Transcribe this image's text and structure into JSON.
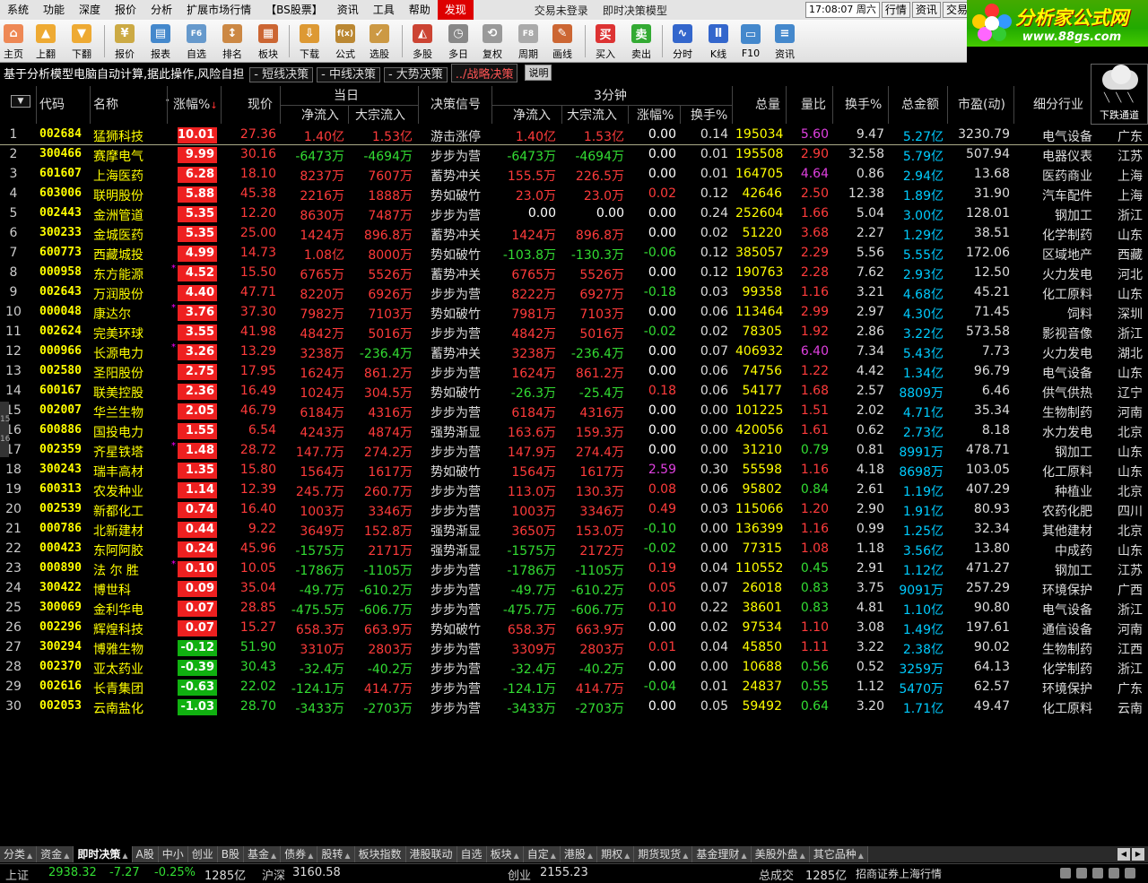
{
  "menu": {
    "items": [
      "系统",
      "功能",
      "深度",
      "报价",
      "分析",
      "扩展市场行情",
      "【BS股票】",
      "资讯",
      "工具",
      "帮助",
      "发现"
    ],
    "active": "发现",
    "title_left": "交易未登录",
    "title_right": "即时决策模型",
    "clock": "17:08:07 周六",
    "right_buttons": [
      "行情",
      "资讯",
      "交易"
    ]
  },
  "logo": {
    "name": "分析家公式网",
    "url": "www.88gs.com"
  },
  "toolbar": [
    {
      "label": "主页",
      "icon": "home-icon"
    },
    {
      "label": "上翻",
      "icon": "up-arrow-icon"
    },
    {
      "label": "下翻",
      "icon": "down-arrow-icon"
    },
    {
      "label": "报价",
      "icon": "yen-icon"
    },
    {
      "label": "报表",
      "icon": "report-icon"
    },
    {
      "label": "自选",
      "icon": "f6-icon"
    },
    {
      "label": "排名",
      "icon": "rank-icon"
    },
    {
      "label": "板块",
      "icon": "blocks-icon"
    },
    {
      "label": "下载",
      "icon": "download-icon"
    },
    {
      "label": "公式",
      "icon": "formula-icon"
    },
    {
      "label": "选股",
      "icon": "select-stock-icon"
    },
    {
      "label": "多股",
      "icon": "multi-stock-icon"
    },
    {
      "label": "多日",
      "icon": "clock-icon"
    },
    {
      "label": "复权",
      "icon": "restore-icon"
    },
    {
      "label": "周期",
      "icon": "f8-icon"
    },
    {
      "label": "画线",
      "icon": "draw-line-icon"
    },
    {
      "label": "买入",
      "icon": "buy-icon"
    },
    {
      "label": "卖出",
      "icon": "sell-icon"
    },
    {
      "label": "分时",
      "icon": "intraday-icon"
    },
    {
      "label": "K线",
      "icon": "kline-icon"
    },
    {
      "label": "F10",
      "icon": "f10-icon"
    },
    {
      "label": "资讯",
      "icon": "news-icon"
    }
  ],
  "infobar": {
    "desc": "基于分析模型电脑自动计算,据此操作,风险自担",
    "tags": [
      "短线决策",
      "中线决策",
      "大势决策"
    ],
    "highlight": "战略决策",
    "help": "说明"
  },
  "weather": {
    "label": "下跌通道"
  },
  "header": {
    "code": "代码",
    "name": "名称",
    "chg": "涨幅%",
    "price": "现价",
    "group_day": "当日",
    "day_net": "净流入",
    "day_big": "大宗流入",
    "signal": "决策信号",
    "group_3m": "3分钟",
    "m_net": "净流入",
    "m_big": "大宗流入",
    "m_chg": "涨幅%",
    "m_turn": "换手%",
    "vol": "总量",
    "vr": "量比",
    "turn": "换手%",
    "amt": "总金额",
    "pe": "市盈(动)",
    "ind": "细分行业"
  },
  "rows": [
    {
      "no": "1",
      "code": "002684",
      "name": "猛狮科技",
      "star": false,
      "chg": "10.01",
      "price": "27.36",
      "d1": "1.40亿",
      "d2": "1.53亿",
      "sig": "游击涨停",
      "m1": "1.40亿",
      "m2": "1.53亿",
      "mc": "0.00",
      "mh": "0.14",
      "vol": "195034",
      "vr": "5.60",
      "turn": "9.47",
      "amt": "5.27亿",
      "pe": "3230.79",
      "ind": "电气设备",
      "reg": "广东"
    },
    {
      "no": "2",
      "code": "300466",
      "name": "赛摩电气",
      "star": false,
      "chg": "9.99",
      "price": "30.16",
      "d1": "-6473万",
      "d2": "-4694万",
      "sig": "步步为营",
      "m1": "-6473万",
      "m2": "-4694万",
      "mc": "0.00",
      "mh": "0.01",
      "vol": "195508",
      "vr": "2.90",
      "turn": "32.58",
      "amt": "5.79亿",
      "pe": "507.94",
      "ind": "电器仪表",
      "reg": "江苏"
    },
    {
      "no": "3",
      "code": "601607",
      "name": "上海医药",
      "star": false,
      "chg": "6.28",
      "price": "18.10",
      "d1": "8237万",
      "d2": "7607万",
      "sig": "蓄势冲关",
      "m1": "155.5万",
      "m2": "226.5万",
      "mc": "0.00",
      "mh": "0.01",
      "vol": "164705",
      "vr": "4.64",
      "turn": "0.86",
      "amt": "2.94亿",
      "pe": "13.68",
      "ind": "医药商业",
      "reg": "上海"
    },
    {
      "no": "4",
      "code": "603006",
      "name": "联明股份",
      "star": false,
      "chg": "5.88",
      "price": "45.38",
      "d1": "2216万",
      "d2": "1888万",
      "sig": "势如破竹",
      "m1": "23.0万",
      "m2": "23.0万",
      "mc": "0.02",
      "mh": "0.12",
      "vol": "42646",
      "vr": "2.50",
      "turn": "12.38",
      "amt": "1.89亿",
      "pe": "31.90",
      "ind": "汽车配件",
      "reg": "上海"
    },
    {
      "no": "5",
      "code": "002443",
      "name": "金洲管道",
      "star": false,
      "chg": "5.35",
      "price": "12.20",
      "d1": "8630万",
      "d2": "7487万",
      "sig": "步步为营",
      "m1": "0.00",
      "m2": "0.00",
      "mc": "0.00",
      "mh": "0.24",
      "vol": "252604",
      "vr": "1.66",
      "turn": "5.04",
      "amt": "3.00亿",
      "pe": "128.01",
      "ind": "钢加工",
      "reg": "浙江"
    },
    {
      "no": "6",
      "code": "300233",
      "name": "金城医药",
      "star": false,
      "chg": "5.35",
      "price": "25.00",
      "d1": "1424万",
      "d2": "896.8万",
      "sig": "蓄势冲关",
      "m1": "1424万",
      "m2": "896.8万",
      "mc": "0.00",
      "mh": "0.02",
      "vol": "51220",
      "vr": "3.68",
      "turn": "2.27",
      "amt": "1.29亿",
      "pe": "38.51",
      "ind": "化学制药",
      "reg": "山东"
    },
    {
      "no": "7",
      "code": "600773",
      "name": "西藏城投",
      "star": false,
      "chg": "4.99",
      "price": "14.73",
      "d1": "1.08亿",
      "d2": "8000万",
      "sig": "势如破竹",
      "m1": "-103.8万",
      "m2": "-130.3万",
      "mc": "-0.06",
      "mh": "0.12",
      "vol": "385057",
      "vr": "2.29",
      "turn": "5.56",
      "amt": "5.55亿",
      "pe": "172.06",
      "ind": "区域地产",
      "reg": "西藏"
    },
    {
      "no": "8",
      "code": "000958",
      "name": "东方能源",
      "star": true,
      "chg": "4.52",
      "price": "15.50",
      "d1": "6765万",
      "d2": "5526万",
      "sig": "蓄势冲关",
      "m1": "6765万",
      "m2": "5526万",
      "mc": "0.00",
      "mh": "0.12",
      "vol": "190763",
      "vr": "2.28",
      "turn": "7.62",
      "amt": "2.93亿",
      "pe": "12.50",
      "ind": "火力发电",
      "reg": "河北"
    },
    {
      "no": "9",
      "code": "002643",
      "name": "万润股份",
      "star": false,
      "chg": "4.40",
      "price": "47.71",
      "d1": "8220万",
      "d2": "6926万",
      "sig": "步步为营",
      "m1": "8222万",
      "m2": "6927万",
      "mc": "-0.18",
      "mh": "0.03",
      "vol": "99358",
      "vr": "1.16",
      "turn": "3.21",
      "amt": "4.68亿",
      "pe": "45.21",
      "ind": "化工原料",
      "reg": "山东"
    },
    {
      "no": "10",
      "code": "000048",
      "name": "康达尔",
      "star": true,
      "chg": "3.76",
      "price": "37.30",
      "d1": "7982万",
      "d2": "7103万",
      "sig": "势如破竹",
      "m1": "7981万",
      "m2": "7103万",
      "mc": "0.00",
      "mh": "0.06",
      "vol": "113464",
      "vr": "2.99",
      "turn": "2.97",
      "amt": "4.30亿",
      "pe": "71.45",
      "ind": "饲料",
      "reg": "深圳"
    },
    {
      "no": "11",
      "code": "002624",
      "name": "完美环球",
      "star": false,
      "chg": "3.55",
      "price": "41.98",
      "d1": "4842万",
      "d2": "5016万",
      "sig": "步步为营",
      "m1": "4842万",
      "m2": "5016万",
      "mc": "-0.02",
      "mh": "0.02",
      "vol": "78305",
      "vr": "1.92",
      "turn": "2.86",
      "amt": "3.22亿",
      "pe": "573.58",
      "ind": "影视音像",
      "reg": "浙江"
    },
    {
      "no": "12",
      "code": "000966",
      "name": "长源电力",
      "star": true,
      "chg": "3.26",
      "price": "13.29",
      "d1": "3238万",
      "d2": "-236.4万",
      "sig": "蓄势冲关",
      "m1": "3238万",
      "m2": "-236.4万",
      "mc": "0.00",
      "mh": "0.07",
      "vol": "406932",
      "vr": "6.40",
      "turn": "7.34",
      "amt": "5.43亿",
      "pe": "7.73",
      "ind": "火力发电",
      "reg": "湖北"
    },
    {
      "no": "13",
      "code": "002580",
      "name": "圣阳股份",
      "star": false,
      "chg": "2.75",
      "price": "17.95",
      "d1": "1624万",
      "d2": "861.2万",
      "sig": "步步为营",
      "m1": "1624万",
      "m2": "861.2万",
      "mc": "0.00",
      "mh": "0.06",
      "vol": "74756",
      "vr": "1.22",
      "turn": "4.42",
      "amt": "1.34亿",
      "pe": "96.79",
      "ind": "电气设备",
      "reg": "山东"
    },
    {
      "no": "14",
      "code": "600167",
      "name": "联美控股",
      "star": false,
      "chg": "2.36",
      "price": "16.49",
      "d1": "1024万",
      "d2": "304.5万",
      "sig": "势如破竹",
      "m1": "-26.3万",
      "m2": "-25.4万",
      "mc": "0.18",
      "mh": "0.06",
      "vol": "54177",
      "vr": "1.68",
      "turn": "2.57",
      "amt": "8809万",
      "pe": "6.46",
      "ind": "供气供热",
      "reg": "辽宁"
    },
    {
      "no": "15",
      "code": "002007",
      "name": "华兰生物",
      "star": false,
      "chg": "2.05",
      "price": "46.79",
      "d1": "6184万",
      "d2": "4316万",
      "sig": "步步为营",
      "m1": "6184万",
      "m2": "4316万",
      "mc": "0.00",
      "mh": "0.00",
      "vol": "101225",
      "vr": "1.51",
      "turn": "2.02",
      "amt": "4.71亿",
      "pe": "35.34",
      "ind": "生物制药",
      "reg": "河南"
    },
    {
      "no": "16",
      "code": "600886",
      "name": "国投电力",
      "star": false,
      "chg": "1.55",
      "price": "6.54",
      "d1": "4243万",
      "d2": "4874万",
      "sig": "强势渐显",
      "m1": "163.6万",
      "m2": "159.3万",
      "mc": "0.00",
      "mh": "0.00",
      "vol": "420056",
      "vr": "1.61",
      "turn": "0.62",
      "amt": "2.73亿",
      "pe": "8.18",
      "ind": "水力发电",
      "reg": "北京"
    },
    {
      "no": "17",
      "code": "002359",
      "name": "齐星铁塔",
      "star": true,
      "chg": "1.48",
      "price": "28.72",
      "d1": "147.7万",
      "d2": "274.2万",
      "sig": "步步为营",
      "m1": "147.9万",
      "m2": "274.4万",
      "mc": "0.00",
      "mh": "0.00",
      "vol": "31210",
      "vr": "0.79",
      "turn": "0.81",
      "amt": "8991万",
      "pe": "478.71",
      "ind": "钢加工",
      "reg": "山东"
    },
    {
      "no": "18",
      "code": "300243",
      "name": "瑞丰高材",
      "star": false,
      "chg": "1.35",
      "price": "15.80",
      "d1": "1564万",
      "d2": "1617万",
      "sig": "势如破竹",
      "m1": "1564万",
      "m2": "1617万",
      "mc": "2.59",
      "mh": "0.30",
      "vol": "55598",
      "vr": "1.16",
      "turn": "4.18",
      "amt": "8698万",
      "pe": "103.05",
      "ind": "化工原料",
      "reg": "山东"
    },
    {
      "no": "19",
      "code": "600313",
      "name": "农发种业",
      "star": false,
      "chg": "1.14",
      "price": "12.39",
      "d1": "245.7万",
      "d2": "260.7万",
      "sig": "步步为营",
      "m1": "113.0万",
      "m2": "130.3万",
      "mc": "0.08",
      "mh": "0.06",
      "vol": "95802",
      "vr": "0.84",
      "turn": "2.61",
      "amt": "1.19亿",
      "pe": "407.29",
      "ind": "种植业",
      "reg": "北京"
    },
    {
      "no": "20",
      "code": "002539",
      "name": "新都化工",
      "star": false,
      "chg": "0.74",
      "price": "16.40",
      "d1": "1003万",
      "d2": "3346万",
      "sig": "步步为营",
      "m1": "1003万",
      "m2": "3346万",
      "mc": "0.49",
      "mh": "0.03",
      "vol": "115066",
      "vr": "1.20",
      "turn": "2.90",
      "amt": "1.91亿",
      "pe": "80.93",
      "ind": "农药化肥",
      "reg": "四川"
    },
    {
      "no": "21",
      "code": "000786",
      "name": "北新建材",
      "star": false,
      "chg": "0.44",
      "price": "9.22",
      "d1": "3649万",
      "d2": "152.8万",
      "sig": "强势渐显",
      "m1": "3650万",
      "m2": "153.0万",
      "mc": "-0.10",
      "mh": "0.00",
      "vol": "136399",
      "vr": "1.16",
      "turn": "0.99",
      "amt": "1.25亿",
      "pe": "32.34",
      "ind": "其他建材",
      "reg": "北京"
    },
    {
      "no": "22",
      "code": "000423",
      "name": "东阿阿胶",
      "star": false,
      "chg": "0.24",
      "price": "45.96",
      "d1": "-1575万",
      "d2": "2171万",
      "sig": "强势渐显",
      "m1": "-1575万",
      "m2": "2172万",
      "mc": "-0.02",
      "mh": "0.00",
      "vol": "77315",
      "vr": "1.08",
      "turn": "1.18",
      "amt": "3.56亿",
      "pe": "13.80",
      "ind": "中成药",
      "reg": "山东"
    },
    {
      "no": "23",
      "code": "000890",
      "name": "法 尔 胜",
      "star": true,
      "chg": "0.10",
      "price": "10.05",
      "d1": "-1786万",
      "d2": "-1105万",
      "sig": "步步为营",
      "m1": "-1786万",
      "m2": "-1105万",
      "mc": "0.19",
      "mh": "0.04",
      "vol": "110552",
      "vr": "0.45",
      "turn": "2.91",
      "amt": "1.12亿",
      "pe": "471.27",
      "ind": "钢加工",
      "reg": "江苏"
    },
    {
      "no": "24",
      "code": "300422",
      "name": "博世科",
      "star": false,
      "chg": "0.09",
      "price": "35.04",
      "d1": "-49.7万",
      "d2": "-610.2万",
      "sig": "步步为营",
      "m1": "-49.7万",
      "m2": "-610.2万",
      "mc": "0.05",
      "mh": "0.07",
      "vol": "26018",
      "vr": "0.83",
      "turn": "3.75",
      "amt": "9091万",
      "pe": "257.29",
      "ind": "环境保护",
      "reg": "广西"
    },
    {
      "no": "25",
      "code": "300069",
      "name": "金利华电",
      "star": false,
      "chg": "0.07",
      "price": "28.85",
      "d1": "-475.5万",
      "d2": "-606.7万",
      "sig": "步步为营",
      "m1": "-475.7万",
      "m2": "-606.7万",
      "mc": "0.10",
      "mh": "0.22",
      "vol": "38601",
      "vr": "0.83",
      "turn": "4.81",
      "amt": "1.10亿",
      "pe": "90.80",
      "ind": "电气设备",
      "reg": "浙江"
    },
    {
      "no": "26",
      "code": "002296",
      "name": "辉煌科技",
      "star": false,
      "chg": "0.07",
      "price": "15.27",
      "d1": "658.3万",
      "d2": "663.9万",
      "sig": "势如破竹",
      "m1": "658.3万",
      "m2": "663.9万",
      "mc": "0.00",
      "mh": "0.02",
      "vol": "97534",
      "vr": "1.10",
      "turn": "3.08",
      "amt": "1.49亿",
      "pe": "197.61",
      "ind": "通信设备",
      "reg": "河南"
    },
    {
      "no": "27",
      "code": "300294",
      "name": "博雅生物",
      "star": false,
      "chg": "-0.12",
      "price": "51.90",
      "d1": "3310万",
      "d2": "2803万",
      "sig": "步步为营",
      "m1": "3309万",
      "m2": "2803万",
      "mc": "0.01",
      "mh": "0.04",
      "vol": "45850",
      "vr": "1.11",
      "turn": "3.22",
      "amt": "2.38亿",
      "pe": "90.02",
      "ind": "生物制药",
      "reg": "江西"
    },
    {
      "no": "28",
      "code": "002370",
      "name": "亚太药业",
      "star": false,
      "chg": "-0.39",
      "price": "30.43",
      "d1": "-32.4万",
      "d2": "-40.2万",
      "sig": "步步为营",
      "m1": "-32.4万",
      "m2": "-40.2万",
      "mc": "0.00",
      "mh": "0.00",
      "vol": "10688",
      "vr": "0.56",
      "turn": "0.52",
      "amt": "3259万",
      "pe": "64.13",
      "ind": "化学制药",
      "reg": "浙江"
    },
    {
      "no": "29",
      "code": "002616",
      "name": "长青集团",
      "star": false,
      "chg": "-0.63",
      "price": "22.02",
      "d1": "-124.1万",
      "d2": "414.7万",
      "sig": "步步为营",
      "m1": "-124.1万",
      "m2": "414.7万",
      "mc": "-0.04",
      "mh": "0.01",
      "vol": "24837",
      "vr": "0.55",
      "turn": "1.12",
      "amt": "5470万",
      "pe": "62.57",
      "ind": "环境保护",
      "reg": "广东"
    },
    {
      "no": "30",
      "code": "002053",
      "name": "云南盐化",
      "star": false,
      "chg": "-1.03",
      "price": "28.70",
      "d1": "-3433万",
      "d2": "-2703万",
      "sig": "步步为营",
      "m1": "-3433万",
      "m2": "-2703万",
      "mc": "0.00",
      "mh": "0.05",
      "vol": "59492",
      "vr": "0.64",
      "turn": "3.20",
      "amt": "1.71亿",
      "pe": "49.47",
      "ind": "化工原料",
      "reg": "云南"
    }
  ],
  "tabs": [
    {
      "label": "分类",
      "arrow": true
    },
    {
      "label": "资金",
      "arrow": true
    },
    {
      "label": "即时决策",
      "arrow": true,
      "active": true
    },
    {
      "label": "A股",
      "arrow": false
    },
    {
      "label": "中小",
      "arrow": false
    },
    {
      "label": "创业",
      "arrow": false
    },
    {
      "label": "B股",
      "arrow": false
    },
    {
      "label": "基金",
      "arrow": true
    },
    {
      "label": "债券",
      "arrow": true
    },
    {
      "label": "股转",
      "arrow": true
    },
    {
      "label": "板块指数",
      "arrow": false
    },
    {
      "label": "港股联动",
      "arrow": false
    },
    {
      "label": "自选",
      "arrow": false
    },
    {
      "label": "板块",
      "arrow": true
    },
    {
      "label": "自定",
      "arrow": true
    },
    {
      "label": "港股",
      "arrow": true
    },
    {
      "label": "期权",
      "arrow": true
    },
    {
      "label": "期货现货",
      "arrow": true
    },
    {
      "label": "基金理财",
      "arrow": true
    },
    {
      "label": "美股外盘",
      "arrow": true
    },
    {
      "label": "其它品种",
      "arrow": true
    }
  ],
  "status": {
    "sh_label": "上证",
    "sh_val": "2938.32",
    "sh_chg": "-7.27",
    "sh_pct": "-0.25%",
    "sh_amt": "1285亿",
    "hs_label": "沪深",
    "hs_val": "3160.58",
    "cy_label": "创业",
    "cy_val": "2155.23",
    "total_label": "总成交",
    "total_val": "1285亿",
    "broker": "招商证券上海行情"
  },
  "colors": {
    "up": "#ff3b3b",
    "down": "#33dd33",
    "code": "#ffff00",
    "amount": "#00ccff",
    "volume_ratio_hot": "#e040e0"
  }
}
